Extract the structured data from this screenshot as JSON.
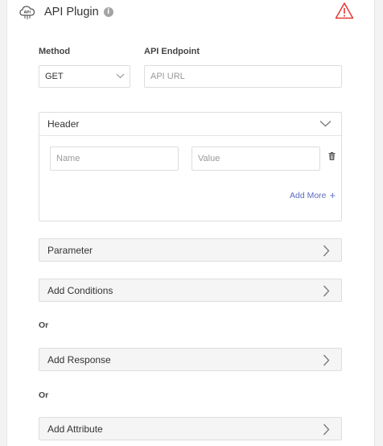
{
  "plugin": {
    "title": "API Plugin",
    "icon": "api-cloud-icon",
    "info_icon": "info-icon",
    "info_glyph": "i",
    "warning_icon": "warning-triangle-icon",
    "warning_color": "#e53935"
  },
  "method": {
    "label": "Method",
    "value": "GET"
  },
  "endpoint": {
    "label": "API Endpoint",
    "placeholder": "API URL"
  },
  "header": {
    "title": "Header",
    "name_placeholder": "Name",
    "value_placeholder": "Value",
    "add_more": "Add More",
    "add_more_icon": "+",
    "accent": "#5c6bc0"
  },
  "parameter": {
    "label": "Parameter"
  },
  "conditions": {
    "label": "Add Conditions"
  },
  "or_1": "Or",
  "response": {
    "label": "Add Response"
  },
  "or_2": "Or",
  "attribute": {
    "label": "Add Attribute"
  }
}
